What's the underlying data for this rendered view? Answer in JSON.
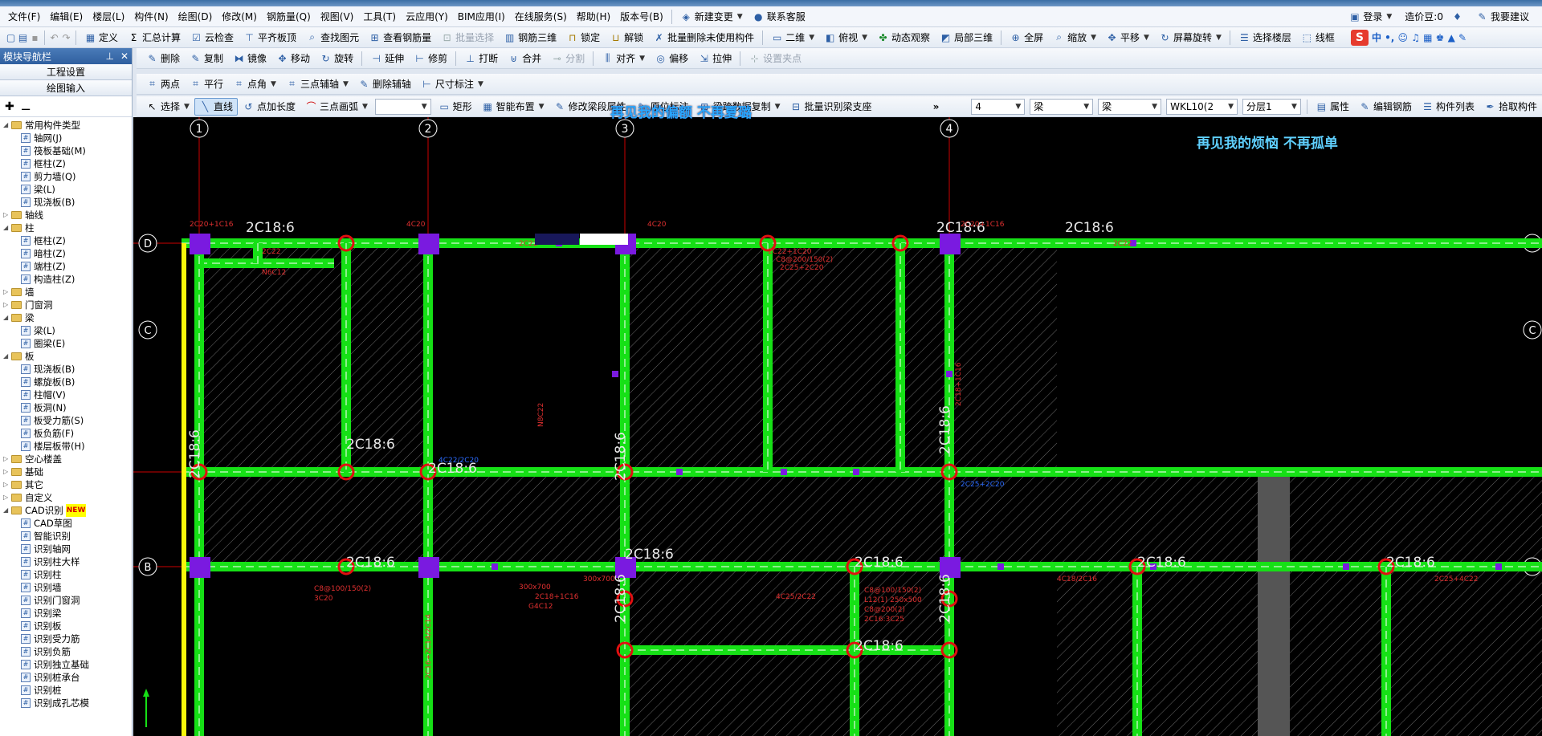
{
  "menu": [
    "文件(F)",
    "编辑(E)",
    "楼层(L)",
    "构件(N)",
    "绘图(D)",
    "修改(M)",
    "钢筋量(Q)",
    "视图(V)",
    "工具(T)",
    "云应用(Y)",
    "BIM应用(I)",
    "在线服务(S)",
    "帮助(H)",
    "版本号(B)"
  ],
  "menu_extra": {
    "new_change": "新建变更",
    "contact": "联系客服",
    "login": "登录",
    "price": "造价豆:0",
    "want_to_suggest": "我要建议"
  },
  "toolbar1": [
    "定义",
    "汇总计算",
    "云检查",
    "平齐板顶",
    "查找图元",
    "查看钢筋量",
    "批量选择",
    "钢筋三维",
    "锁定",
    "解锁",
    "批量删除未使用构件",
    "二维",
    "俯视",
    "动态观察",
    "局部三维",
    "全屏",
    "缩放",
    "平移",
    "屏幕旋转",
    "选择楼层",
    "线框"
  ],
  "toolbar2": [
    "删除",
    "复制",
    "镜像",
    "移动",
    "旋转",
    "延伸",
    "修剪",
    "打断",
    "合并",
    "分割",
    "对齐",
    "偏移",
    "拉伸",
    "设置夹点"
  ],
  "toolbar2b": [
    "两点",
    "平行",
    "点角",
    "三点辅轴",
    "删除辅轴",
    "尺寸标注"
  ],
  "toolbar3": [
    "选择",
    "直线",
    "点加长度",
    "三点画弧",
    "矩形",
    "智能布置",
    "修改梁段属性",
    "原位标注",
    "梁跨数据复制",
    "批量识别梁支座"
  ],
  "toolbar3_right": {
    "floor": "4",
    "type1": "梁",
    "type2": "梁",
    "element": "WKL10(2",
    "layer": "分层1",
    "prop": "属性",
    "edit_rebar": "编辑钢筋",
    "list": "构件列表",
    "pick": "拾取构件"
  },
  "nav": {
    "title": "模块导航栏",
    "project_settings": "工程设置",
    "drawing_input": "绘图输入",
    "tree": [
      {
        "level": 0,
        "type": "folder",
        "label": "常用构件类型",
        "expanded": true
      },
      {
        "level": 1,
        "type": "leaf",
        "label": "轴网(J)"
      },
      {
        "level": 1,
        "type": "leaf",
        "label": "筏板基础(M)"
      },
      {
        "level": 1,
        "type": "leaf",
        "label": "框柱(Z)"
      },
      {
        "level": 1,
        "type": "leaf",
        "label": "剪力墙(Q)"
      },
      {
        "level": 1,
        "type": "leaf",
        "label": "梁(L)"
      },
      {
        "level": 1,
        "type": "leaf",
        "label": "现浇板(B)"
      },
      {
        "level": 0,
        "type": "folder",
        "label": "轴线",
        "expanded": false
      },
      {
        "level": 0,
        "type": "folder",
        "label": "柱",
        "expanded": true
      },
      {
        "level": 1,
        "type": "leaf",
        "label": "框柱(Z)"
      },
      {
        "level": 1,
        "type": "leaf",
        "label": "暗柱(Z)"
      },
      {
        "level": 1,
        "type": "leaf",
        "label": "端柱(Z)"
      },
      {
        "level": 1,
        "type": "leaf",
        "label": "构造柱(Z)"
      },
      {
        "level": 0,
        "type": "folder",
        "label": "墙",
        "expanded": false
      },
      {
        "level": 0,
        "type": "folder",
        "label": "门窗洞",
        "expanded": false
      },
      {
        "level": 0,
        "type": "folder",
        "label": "梁",
        "expanded": true
      },
      {
        "level": 1,
        "type": "leaf",
        "label": "梁(L)"
      },
      {
        "level": 1,
        "type": "leaf",
        "label": "圈梁(E)"
      },
      {
        "level": 0,
        "type": "folder",
        "label": "板",
        "expanded": true
      },
      {
        "level": 1,
        "type": "leaf",
        "label": "现浇板(B)"
      },
      {
        "level": 1,
        "type": "leaf",
        "label": "螺旋板(B)"
      },
      {
        "level": 1,
        "type": "leaf",
        "label": "柱帽(V)"
      },
      {
        "level": 1,
        "type": "leaf",
        "label": "板洞(N)"
      },
      {
        "level": 1,
        "type": "leaf",
        "label": "板受力筋(S)"
      },
      {
        "level": 1,
        "type": "leaf",
        "label": "板负筋(F)"
      },
      {
        "level": 1,
        "type": "leaf",
        "label": "楼层板带(H)"
      },
      {
        "level": 0,
        "type": "folder",
        "label": "空心楼盖",
        "expanded": false
      },
      {
        "level": 0,
        "type": "folder",
        "label": "基础",
        "expanded": false
      },
      {
        "level": 0,
        "type": "folder",
        "label": "其它",
        "expanded": false
      },
      {
        "level": 0,
        "type": "folder",
        "label": "自定义",
        "expanded": false
      },
      {
        "level": 0,
        "type": "folder",
        "label": "CAD识别",
        "expanded": true,
        "new": "NEW"
      },
      {
        "level": 1,
        "type": "leaf",
        "label": "CAD草图"
      },
      {
        "level": 1,
        "type": "leaf",
        "label": "智能识别"
      },
      {
        "level": 1,
        "type": "leaf",
        "label": "识别轴网"
      },
      {
        "level": 1,
        "type": "leaf",
        "label": "识别柱大样"
      },
      {
        "level": 1,
        "type": "leaf",
        "label": "识别柱"
      },
      {
        "level": 1,
        "type": "leaf",
        "label": "识别墙"
      },
      {
        "level": 1,
        "type": "leaf",
        "label": "识别门窗洞"
      },
      {
        "level": 1,
        "type": "leaf",
        "label": "识别梁"
      },
      {
        "level": 1,
        "type": "leaf",
        "label": "识别板"
      },
      {
        "level": 1,
        "type": "leaf",
        "label": "识别受力筋"
      },
      {
        "level": 1,
        "type": "leaf",
        "label": "识别负筋"
      },
      {
        "level": 1,
        "type": "leaf",
        "label": "识别独立基础"
      },
      {
        "level": 1,
        "type": "leaf",
        "label": "识别桩承台"
      },
      {
        "level": 1,
        "type": "leaf",
        "label": "识别桩"
      },
      {
        "level": 1,
        "type": "leaf",
        "label": "识别成孔芯模"
      }
    ]
  },
  "overlay_text": "再见我的烦恼 不再孤单",
  "overlay_text_mid": "再见我的偏额 不再夏璐",
  "canvas": {
    "axes_vertical": [
      "1",
      "2",
      "3",
      "4"
    ],
    "axes_horizontal": [
      "D",
      "C",
      "B"
    ],
    "beam_labels": [
      "2C18:6",
      "2C18:6",
      "2C18:6",
      "2C18:6",
      "2C18:6",
      "2C18:6",
      "2C18:6",
      "2C18:6",
      "2C18:6",
      "2C18:6",
      "2C18:6",
      "2C18:6",
      "2C18:6",
      "2C18:6",
      "2C18:6",
      "2C18:6"
    ],
    "annot": [
      "2C20+1C16",
      "4C20",
      "2C22",
      "4C20",
      "2C20+1C16",
      "2C22",
      "C8@200/150(2)",
      "N6C12",
      "2C22+1C20",
      "2C22",
      "N8C22",
      "2C18+1C16",
      "2C25+2C20",
      "C8@100/150(2)",
      "3C20",
      "300x700",
      "2C18+1C16",
      "G4C12",
      "300x700",
      "2C25+2C20",
      "4C22/2C20",
      "2C16+2C14/2C14",
      "4C18/2C16",
      "2C25+4C22",
      "4C25/2C22",
      "C8@100/150(2)",
      "L12(1) 250x500",
      "C8@200(2)",
      "2C16:3C25",
      "N2C12"
    ]
  }
}
